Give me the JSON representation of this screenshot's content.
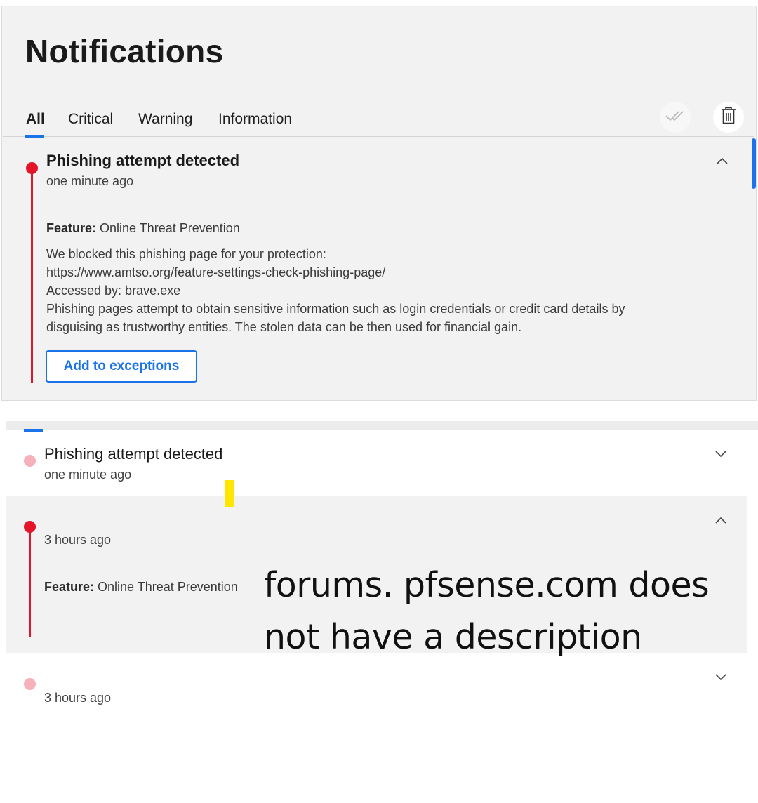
{
  "header": {
    "title": "Notifications",
    "tabs": [
      {
        "label": "All",
        "active": true
      },
      {
        "label": "Critical",
        "active": false
      },
      {
        "label": "Warning",
        "active": false
      },
      {
        "label": "Information",
        "active": false
      }
    ],
    "actions": {
      "mark_all_read_icon": "double-check-icon",
      "delete_all_icon": "trash-icon"
    }
  },
  "notifications": [
    {
      "title": "Phishing attempt detected",
      "time": "one minute ago",
      "feature_label": "Feature:",
      "feature_value": "Online Threat Prevention",
      "body": [
        "We blocked this phishing page for your protection:",
        "https://www.amtso.org/feature-settings-check-phishing-page/",
        "Accessed by: brave.exe",
        "Phishing pages attempt to obtain sensitive information such as login credentials or credit card details by",
        "disguising as trustworthy entities. The stolen data can be then used for financial gain."
      ],
      "action_label": "Add to exceptions",
      "severity": "critical",
      "expanded": true
    },
    {
      "title": "Phishing attempt detected",
      "time": "one minute ago",
      "severity": "critical",
      "read": true,
      "expanded": false
    },
    {
      "title": "",
      "time": "3 hours ago",
      "feature_label": "Feature:",
      "feature_value": "Online Threat Prevention",
      "severity": "critical",
      "expanded": true
    },
    {
      "title": "",
      "time": "3 hours ago",
      "severity": "critical",
      "read": true,
      "expanded": false
    }
  ],
  "overlay_note": {
    "line1": "forums. pfsense.com does",
    "line2": "not have a description"
  },
  "colors": {
    "accent": "#1a73e8",
    "critical": "#e4142a",
    "critical_read": "#f6b1b9",
    "panel_bg": "#f2f2f2",
    "highlight": "#ffe600"
  }
}
